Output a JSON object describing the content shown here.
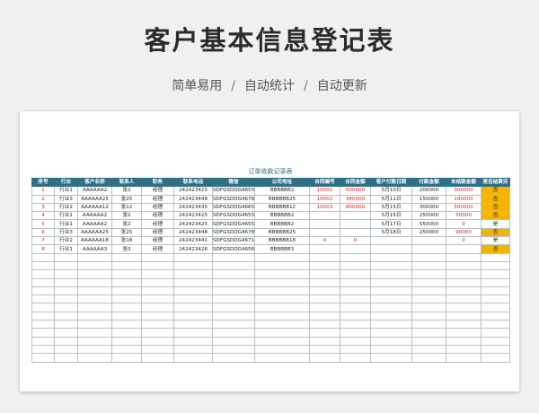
{
  "page": {
    "title": "客户基本信息登记表",
    "subtitle_items": [
      "简单易用",
      "自动统计",
      "自动更新"
    ],
    "subtitle_separator": "/"
  },
  "sheet": {
    "title": "订单收款记录表",
    "headers": [
      "序号",
      "行业",
      "客户名称",
      "联系人",
      "职务",
      "联系电话",
      "微信",
      "公司地址",
      "合同编号",
      "合同金额",
      "客户付款日期",
      "付款金额",
      "未结款金额",
      "是否结算完"
    ],
    "rows": [
      [
        "1",
        "行业1",
        "AAAAAA2",
        "张2",
        "经理",
        "242423425",
        "SDFGSDDG4655",
        "BBBBBB2",
        "10001",
        "500000",
        "5月10日",
        "200000",
        "300000",
        "否"
      ],
      [
        "2",
        "行业3",
        "AAAAAA25",
        "张25",
        "经理",
        "242423448",
        "SDFGSDDG4678",
        "BBBBBB25",
        "10002",
        "340000",
        "5月11日",
        "150000",
        "190000",
        "否"
      ],
      [
        "3",
        "行业2",
        "AAAAAA12",
        "张12",
        "经理",
        "242423435",
        "SDFGSDDG4665",
        "BBBBBB12",
        "10003",
        "800000",
        "5月15日",
        "300000",
        "500000",
        "否"
      ],
      [
        "4",
        "行业1",
        "AAAAAA2",
        "张2",
        "经理",
        "242423425",
        "SDFGSDDG4655",
        "BBBBBB2",
        "",
        "",
        "5月15日",
        "250000",
        "50000",
        "否"
      ],
      [
        "5",
        "行业1",
        "AAAAAA2",
        "张2",
        "经理",
        "242423425",
        "SDFGSDDG4655",
        "BBBBBB2",
        "",
        "",
        "5月17日",
        "550000",
        "0",
        "是"
      ],
      [
        "6",
        "行业3",
        "AAAAAA25",
        "张25",
        "经理",
        "242423448",
        "SDFGSDDG4678",
        "BBBBBB25",
        "",
        "",
        "5月18日",
        "250000",
        "90000",
        "否"
      ],
      [
        "7",
        "行业2",
        "AAAAAA18",
        "张18",
        "经理",
        "242423441",
        "SDFGSDDG4671",
        "BBBBBB18",
        "0",
        "0",
        "",
        "",
        "0",
        "是"
      ],
      [
        "8",
        "行业1",
        "AAAAAA3",
        "张3",
        "经理",
        "242423426",
        "SDFGSDDG4656",
        "BBBBBB3",
        "",
        "",
        "",
        "",
        "",
        "否"
      ]
    ],
    "empty_row_count": 13,
    "colors": {
      "header_bg": "#2f6f87",
      "title_text": "#2b6d86",
      "red_text": "#e02020",
      "flag_no_bg": "#f5b400"
    }
  }
}
